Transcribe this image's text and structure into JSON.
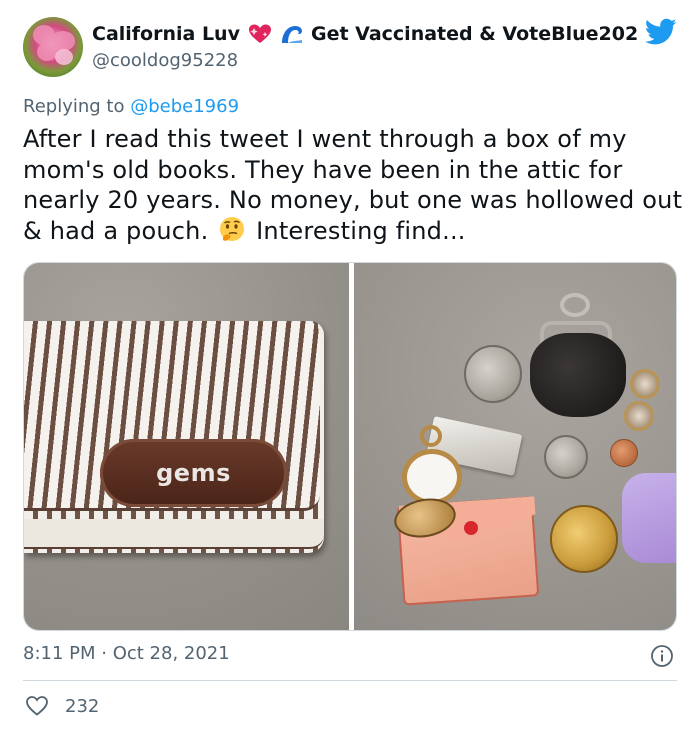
{
  "tweet": {
    "display_name": "California Luv",
    "display_name_suffix": "Get Vaccinated & VoteBlue202",
    "handle": "@cooldog95228",
    "reply_prefix": "Replying to",
    "reply_handle": "@bebe1969",
    "text_part1": "After I read this tweet I went through a box of my mom's old books. They have been in the attic for nearly 20 years. No money, but one was hollowed out & had a pouch.",
    "text_part2": "Interesting find...",
    "timestamp": "8:11 PM · Oct 28, 2021",
    "like_count": "232"
  },
  "media": {
    "left_photo_label_text": "gems"
  },
  "icons": {
    "avatar": "flower-avatar",
    "emoji_1": "sparkling-heart-emoji",
    "emoji_2": "water-wave-emoji",
    "brand": "twitter-bird-icon",
    "emoji_inline": "thinking-face-emoji",
    "info": "info-icon",
    "like": "heart-outline-icon"
  },
  "colors": {
    "brand_blue": "#1d9bf0",
    "secondary_text": "#536471",
    "primary_text": "#0f1419",
    "divider": "#cfd9de"
  }
}
